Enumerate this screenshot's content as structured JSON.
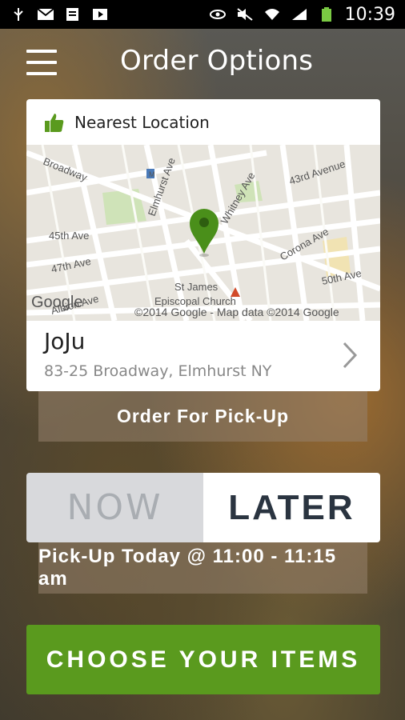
{
  "status_bar": {
    "time": "10:39"
  },
  "header": {
    "title": "Order Options"
  },
  "location_card": {
    "heading": "Nearest Location",
    "name": "JoJu",
    "address": "83-25 Broadway, Elmhurst NY",
    "map": {
      "streets": [
        "Broadway",
        "Elmhurst Ave",
        "Whitney Ave",
        "43rd Avenue",
        "45th Ave",
        "47th Ave",
        "Corona Ave",
        "50th Ave",
        "Albion Ave"
      ],
      "poi": [
        "St James",
        "Episcopal Church"
      ],
      "attribution": "©2014 Google - Map data ©2014 Google",
      "logo": "Google"
    }
  },
  "order_type_label": "Order For Pick-Up",
  "time_toggle": {
    "now": "NOW",
    "later": "LATER",
    "selected": "LATER"
  },
  "pickup_time_label": "Pick-Up Today @ 11:00 - 11:15 am",
  "cta": {
    "label": "CHOOSE YOUR ITEMS"
  },
  "colors": {
    "accent_green": "#5a9a1e",
    "pin_green": "#4a8f1a",
    "status_bar": "#000000"
  }
}
